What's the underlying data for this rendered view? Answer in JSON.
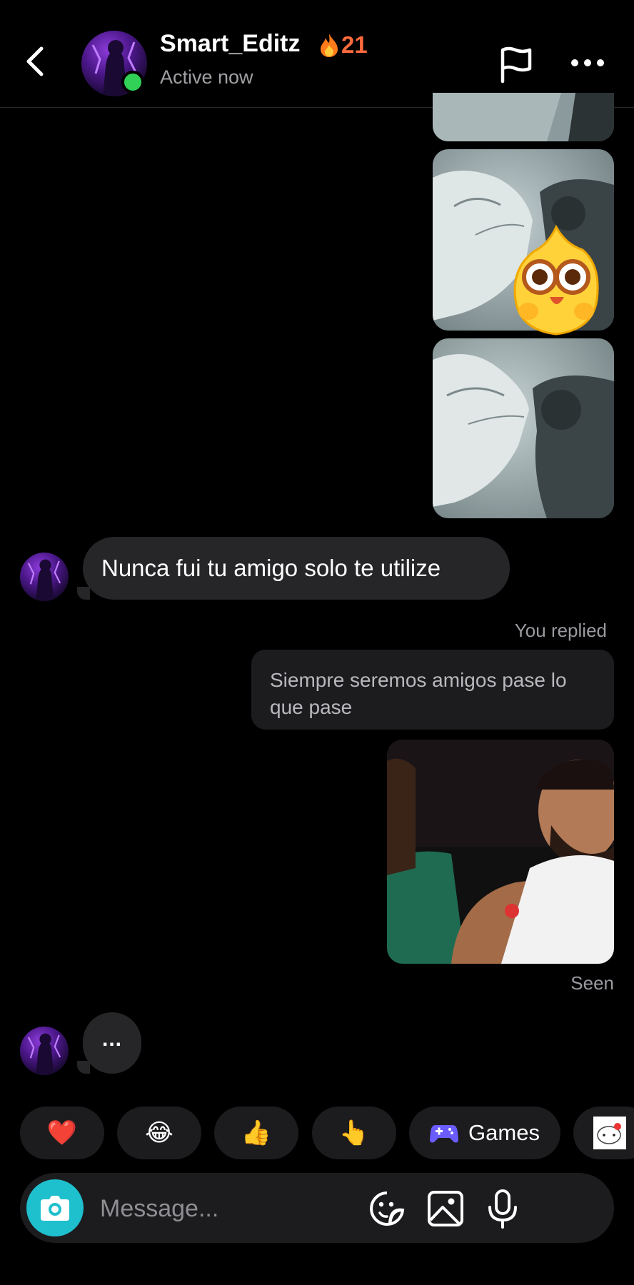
{
  "header": {
    "back_icon": "chevron-left-icon",
    "username": "Smart_Editz",
    "streak_icon": "fire-emoji",
    "streak_count": "21",
    "status": "Active now",
    "actions": [
      "flag-icon",
      "more-horizontal-icon"
    ]
  },
  "messages": {
    "incoming_text": "Nunca fui tu amigo solo te utilize",
    "you_replied_label": "You replied",
    "reply_quote": "Siempre seremos amigos pase lo que pase",
    "seen_label": "Seen",
    "typing_indicator": "..."
  },
  "quick_reactions": {
    "items": [
      "❤️",
      "😂",
      "👍",
      "👆"
    ],
    "games_label": "Games"
  },
  "composer": {
    "placeholder": "Message...",
    "icons": [
      "camera-icon",
      "sticker-icon",
      "gallery-icon",
      "microphone-icon"
    ]
  },
  "colors": {
    "background": "#000000",
    "bubble": "#262628",
    "online": "#31d158",
    "camera": "#1fc0ce",
    "streak": "#ff6a3d"
  }
}
